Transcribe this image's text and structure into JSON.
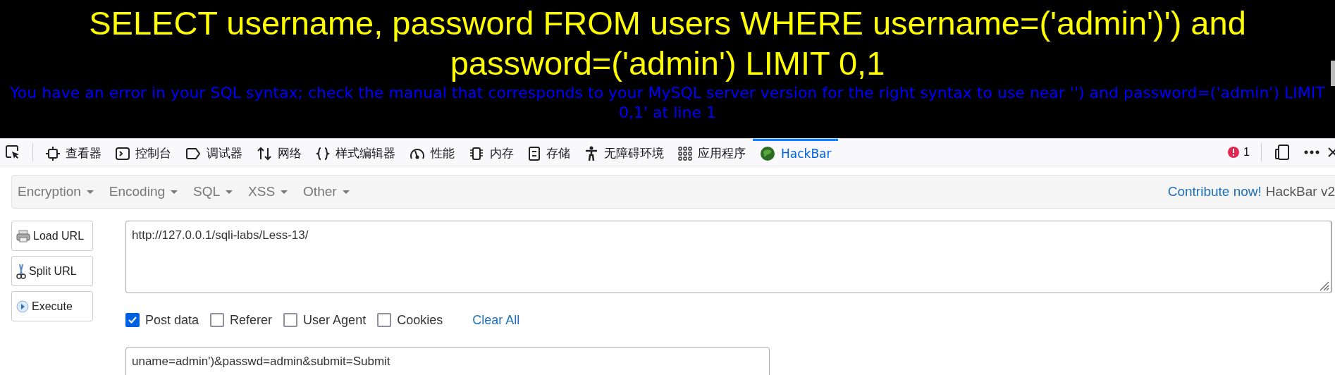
{
  "page": {
    "query": "SELECT username, password FROM users WHERE username=('admin')') and password=('admin') LIMIT 0,1",
    "error": "You have an error in your SQL syntax; check the manual that corresponds to your MySQL server version for the right syntax to use near '') and password=('admin') LIMIT 0,1' at line 1"
  },
  "devtools": {
    "tabs": [
      {
        "label": "查看器",
        "kind": "inspector",
        "selected": false
      },
      {
        "label": "控制台",
        "kind": "console",
        "selected": false
      },
      {
        "label": "调试器",
        "kind": "debugger",
        "selected": false
      },
      {
        "label": "网络",
        "kind": "network",
        "selected": false
      },
      {
        "label": "样式编辑器",
        "kind": "style",
        "selected": false
      },
      {
        "label": "性能",
        "kind": "performance",
        "selected": false
      },
      {
        "label": "内存",
        "kind": "memory",
        "selected": false
      },
      {
        "label": "存储",
        "kind": "storage",
        "selected": false
      },
      {
        "label": "无障碍环境",
        "kind": "accessibility",
        "selected": false
      },
      {
        "label": "应用程序",
        "kind": "application",
        "selected": false
      },
      {
        "label": "HackBar",
        "kind": "hackbar",
        "selected": true
      }
    ],
    "error_count": "1"
  },
  "hackbar": {
    "menus": [
      {
        "label": "Encryption"
      },
      {
        "label": "Encoding"
      },
      {
        "label": "SQL"
      },
      {
        "label": "XSS"
      },
      {
        "label": "Other"
      }
    ],
    "contribute": "Contribute now!",
    "brand": "HackBar v2",
    "actions": [
      {
        "label": "Load URL",
        "kind": "load"
      },
      {
        "label": "Split URL",
        "kind": "split"
      },
      {
        "label": "Execute",
        "kind": "execute"
      }
    ],
    "url": "http://127.0.0.1/sqli-labs/Less-13/",
    "options": [
      {
        "label": "Post data",
        "checked": true
      },
      {
        "label": "Referer",
        "checked": false
      },
      {
        "label": "User Agent",
        "checked": false
      },
      {
        "label": "Cookies",
        "checked": false
      }
    ],
    "clear_all": "Clear All",
    "post_data": "uname=admin')&passwd=admin&submit=Submit"
  }
}
